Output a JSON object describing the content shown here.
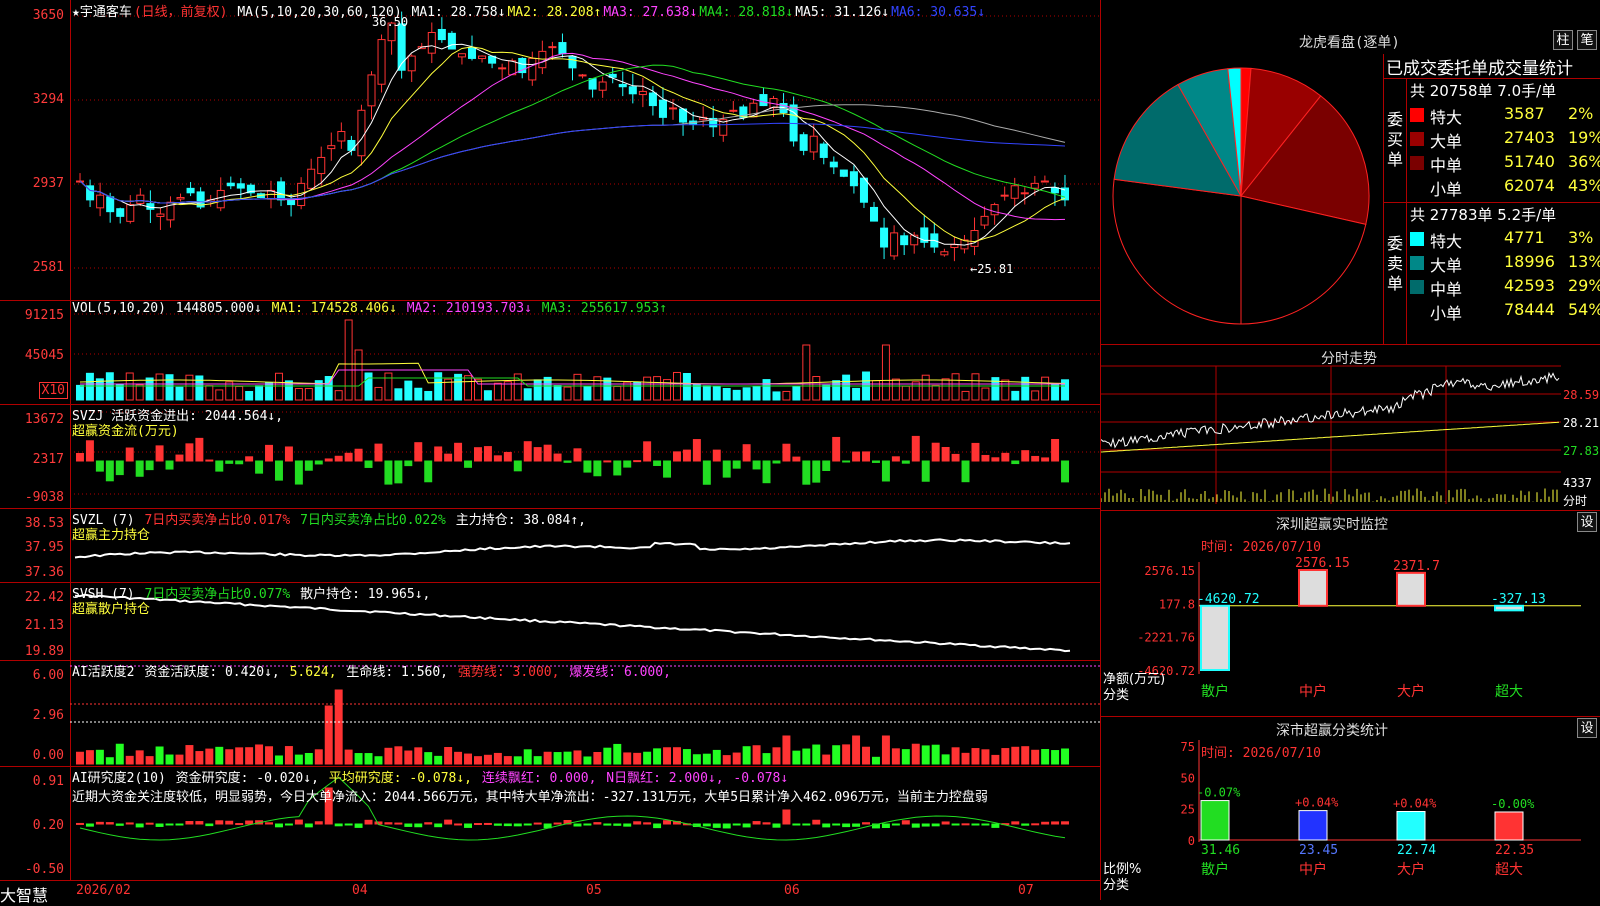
{
  "stock": {
    "title": "★宇通客车",
    "mode": "(日线，前复权)"
  },
  "colors": {
    "up": "#ff3333",
    "down": "#22ffff",
    "grid": "#b00000",
    "ma1": "#ffffff",
    "ma2": "#ffff3c",
    "ma3": "#ff44ff",
    "ma4": "#22dd22",
    "ma5": "#aaaaaa",
    "ma6": "#3344ff"
  },
  "kline": {
    "ma_header": "MA(5,10,20,30,60,120)",
    "mas": [
      {
        "label": "MA1:",
        "value": "28.758↓",
        "color": "#ffffff"
      },
      {
        "label": "MA2:",
        "value": "28.208↑",
        "color": "#ffff3c"
      },
      {
        "label": "MA3:",
        "value": "27.638↓",
        "color": "#ff44ff"
      },
      {
        "label": "MA4:",
        "value": "28.818↓",
        "color": "#22dd22"
      },
      {
        "label": "MA5:",
        "value": "31.126↓",
        "color": "#ffffff"
      },
      {
        "label": "MA6:",
        "value": "30.635↓",
        "color": "#3344ff"
      }
    ],
    "yticks": [
      "3650",
      "3294",
      "2937",
      "2581"
    ],
    "high_label": "36.50",
    "low_label": "←25.81"
  },
  "vol": {
    "header": "VOL(5,10,20)",
    "value": "144805.000↓",
    "ma1": "MA1: 174528.406↓",
    "ma2": "MA2: 210193.703↓",
    "ma3": "MA3: 255617.953↑",
    "yticks": [
      "91215",
      "45045"
    ],
    "unit": "X10"
  },
  "svzj": {
    "header": "SVZJ  活跃资金进出: 2044.564↓,",
    "sub": "超赢资金流(万元)",
    "yticks": [
      "13672",
      "2317",
      "-9038"
    ]
  },
  "svzl": {
    "header": "SVZL (7)",
    "a": "7日内买卖净占比0.017%",
    "b": "7日内买卖净占比0.022%",
    "c": "主力持仓: 38.084↑,",
    "sub": "超赢主力持仓",
    "yticks": [
      "38.53",
      "37.95",
      "37.36"
    ]
  },
  "svsh": {
    "header": "SVSH (7)",
    "a": "7日内买卖净占比0.077%",
    "c": "散户持仓: 19.965↓,",
    "sub": "超赢散户持仓",
    "yticks": [
      "22.42",
      "21.13",
      "19.89"
    ]
  },
  "ai1": {
    "header": "AI活跃度2",
    "a": "资金活跃度: 0.420↓,",
    "b": "5.624,",
    "c": "生命线: 1.560,",
    "d": "强势线: 3.000,",
    "e": "爆发线: 6.000,",
    "yticks": [
      "6.00",
      "2.96",
      "0.00"
    ]
  },
  "ai2": {
    "header": "AI研究度2(10)",
    "a": "资金研究度: -0.020↓,",
    "b": "平均研究度: -0.078↓,",
    "c": "连续飘红: 0.000,",
    "d": "N日飘红: 2.000↓,",
    "e": "-0.078↓",
    "text": "近期大资金关注度较低，明显弱势，今日大单净流入：2044.566万元，其中特大单净流出：-327.131万元，大单5日累计净入462.096万元，当前主力控盘弱",
    "yticks": [
      "0.91",
      "0.20",
      "-0.50"
    ]
  },
  "xaxis": {
    "brand": "大智慧",
    "labels": [
      "2026/02",
      "04",
      "05",
      "06",
      "07"
    ]
  },
  "longhu": {
    "title": "龙虎看盘(逐单)",
    "btn1": "柱",
    "btn2": "笔",
    "table_title": "已成交委托单成交量统计",
    "buy": {
      "side": "委买单",
      "total": "共 20758单 7.0手/单",
      "rows": [
        {
          "name": "特大",
          "vol": "3587",
          "pct": "2%",
          "color": "#ff0000"
        },
        {
          "name": "大单",
          "vol": "27403",
          "pct": "19%",
          "color": "#990000"
        },
        {
          "name": "中单",
          "vol": "51740",
          "pct": "36%",
          "color": "#7a0000"
        },
        {
          "name": "小单",
          "vol": "62074",
          "pct": "43%",
          "color": "#000000"
        }
      ]
    },
    "sell": {
      "side": "委卖单",
      "total": "共 27783单 5.2手/单",
      "rows": [
        {
          "name": "特大",
          "vol": "4771",
          "pct": "3%",
          "color": "#00ffff"
        },
        {
          "name": "大单",
          "vol": "18996",
          "pct": "13%",
          "color": "#008888"
        },
        {
          "name": "中单",
          "vol": "42593",
          "pct": "29%",
          "color": "#006b6b"
        },
        {
          "name": "小单",
          "vol": "78444",
          "pct": "54%",
          "color": "#000000"
        }
      ]
    }
  },
  "fenshi": {
    "title": "分时走势",
    "yticks": [
      "28.59",
      "28.21",
      "27.83"
    ],
    "vol_label": "4337",
    "vol_unit": "分时"
  },
  "monitor": {
    "title": "深圳超赢实时监控",
    "btn": "设",
    "time": "时间: 2026/07/10",
    "yticks": [
      "2576.15",
      "177.8",
      "-2221.76",
      "-4620.72"
    ],
    "ylabel": "净额(万元)",
    "xlabel": "分类",
    "bars": [
      {
        "name": "散户",
        "value": -4620.72,
        "label": "-4620.72"
      },
      {
        "name": "中户",
        "value": 2576.15,
        "label": "2576.15"
      },
      {
        "name": "大户",
        "value": 2371.7,
        "label": "2371.7"
      },
      {
        "name": "超大",
        "value": -327.13,
        "label": "-327.13"
      }
    ]
  },
  "classify": {
    "title": "深市超赢分类统计",
    "btn": "设",
    "time": "时间: 2026/07/10",
    "yticks": [
      "75",
      "50",
      "25",
      "0"
    ],
    "ylabel": "比例%",
    "xlabel": "分类",
    "bars": [
      {
        "name": "散户",
        "value": 31.46,
        "change": "-0.07%",
        "color": "#22dd22"
      },
      {
        "name": "中户",
        "value": 23.45,
        "change": "+0.04%",
        "color": "#2233ff"
      },
      {
        "name": "大户",
        "value": 22.74,
        "change": "+0.04%",
        "color": "#22ffff"
      },
      {
        "name": "超大",
        "value": 22.35,
        "change": "-0.00%",
        "color": "#ff3333"
      }
    ]
  }
}
